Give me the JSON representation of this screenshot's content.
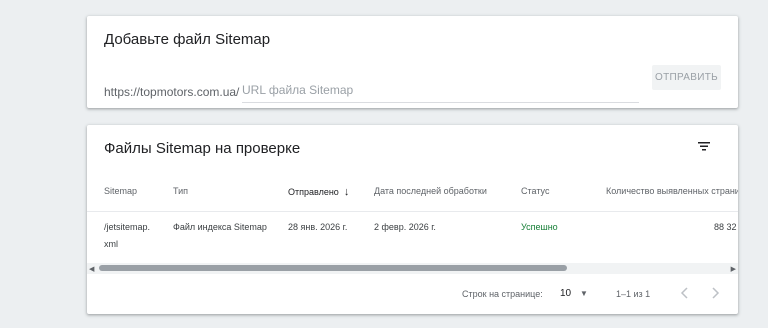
{
  "add_sitemap": {
    "title": "Добавьте файл Sitemap",
    "url_prefix": "https://topmotors.com.ua/",
    "url_placeholder": "URL файла Sitemap",
    "submit_label": "ОТПРАВИТЬ"
  },
  "sitemaps": {
    "title": "Файлы Sitemap на проверке",
    "columns": {
      "sitemap": "Sitemap",
      "type": "Тип",
      "submitted": "Отправлено",
      "last_read": "Дата последней обработки",
      "status": "Статус",
      "discovered": "Количество выявленных страни"
    },
    "rows": [
      {
        "sitemap_line1": "/jetsitemap.",
        "sitemap_line2": "xml",
        "type": "Файл индекса Sitemap",
        "submitted": "28 янв. 2026 г.",
        "last_read": "2 февр. 2026 г.",
        "status": "Успешно",
        "discovered": "88 32"
      }
    ]
  },
  "pagination": {
    "rows_per_page_label": "Строк на странице:",
    "rows_per_page_value": "10",
    "range": "1–1 из 1"
  },
  "colors": {
    "background": "#eceff1",
    "status_success": "#188038",
    "disabled_button_text": "#9aa0a6"
  },
  "icons": {
    "filter": "filter-icon",
    "sort": "arrow-down-icon",
    "prev": "chevron-left-icon",
    "next": "chevron-right-icon"
  }
}
